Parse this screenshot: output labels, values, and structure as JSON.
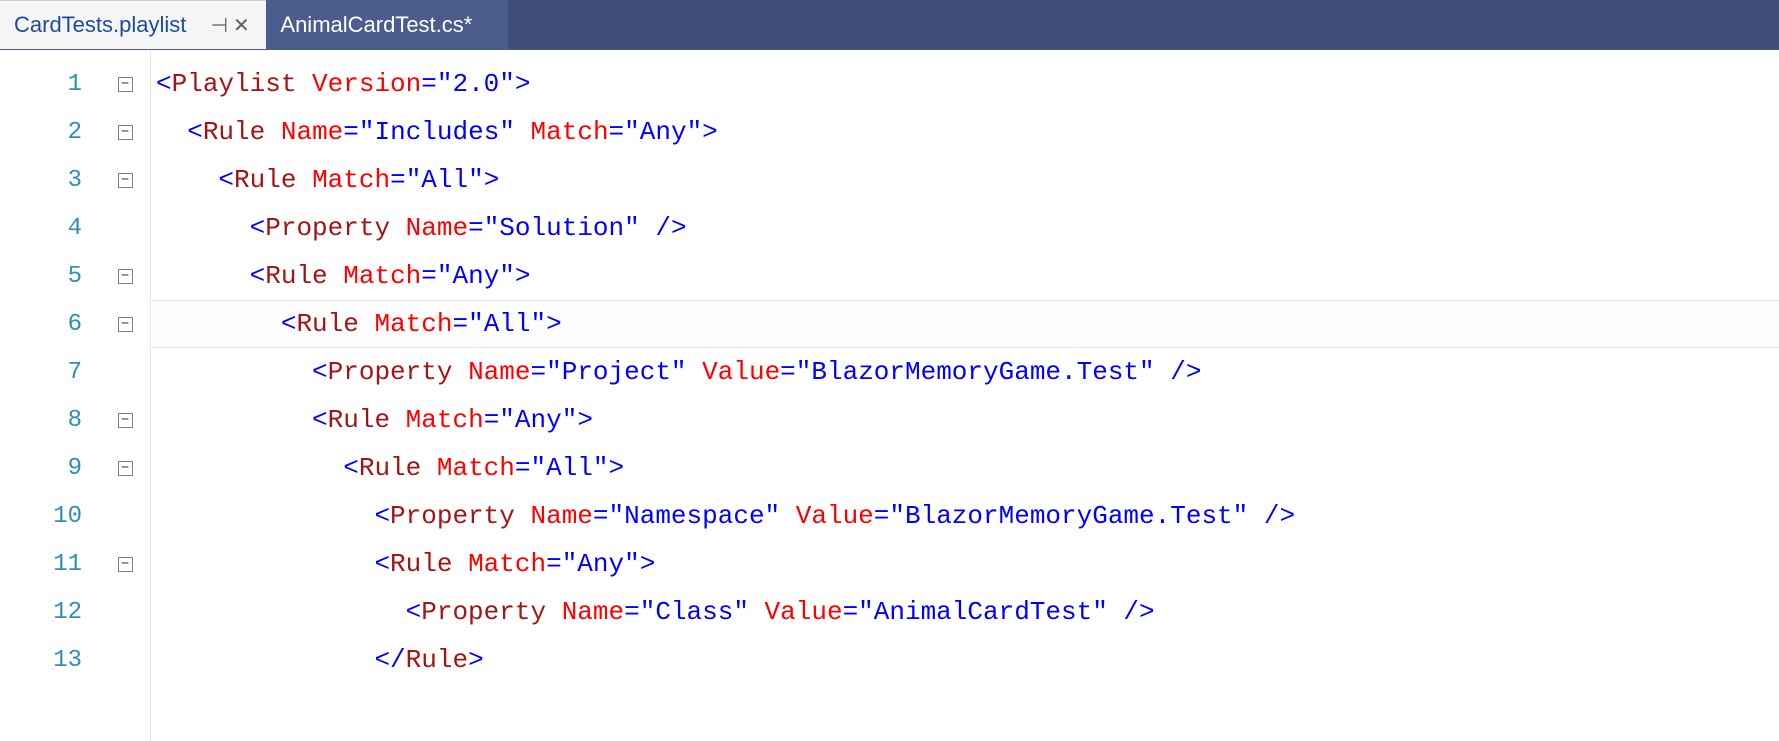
{
  "tabs": [
    {
      "label": "CardTests.playlist",
      "active": true,
      "pinned": true,
      "dirty": false
    },
    {
      "label": "AnimalCardTest.cs*",
      "active": false,
      "pinned": false,
      "dirty": true
    }
  ],
  "icons": {
    "pin": "⊣",
    "close": "✕",
    "collapse": "−"
  },
  "highlight_line": 6,
  "code_lines": [
    {
      "num": 1,
      "fold": true,
      "fold_first": true,
      "indent": 0,
      "tokens": [
        {
          "t": "p",
          "v": "<"
        },
        {
          "t": "el",
          "v": "Playlist"
        },
        {
          "t": "plain",
          "v": " "
        },
        {
          "t": "at",
          "v": "Version"
        },
        {
          "t": "eq",
          "v": "="
        },
        {
          "t": "st",
          "v": "\"2.0\""
        },
        {
          "t": "p",
          "v": ">"
        }
      ]
    },
    {
      "num": 2,
      "fold": true,
      "indent": 1,
      "tokens": [
        {
          "t": "p",
          "v": "<"
        },
        {
          "t": "el",
          "v": "Rule"
        },
        {
          "t": "plain",
          "v": " "
        },
        {
          "t": "at",
          "v": "Name"
        },
        {
          "t": "eq",
          "v": "="
        },
        {
          "t": "st",
          "v": "\"Includes\""
        },
        {
          "t": "plain",
          "v": " "
        },
        {
          "t": "at",
          "v": "Match"
        },
        {
          "t": "eq",
          "v": "="
        },
        {
          "t": "st",
          "v": "\"Any\""
        },
        {
          "t": "p",
          "v": ">"
        }
      ]
    },
    {
      "num": 3,
      "fold": true,
      "indent": 2,
      "tokens": [
        {
          "t": "p",
          "v": "<"
        },
        {
          "t": "el",
          "v": "Rule"
        },
        {
          "t": "plain",
          "v": " "
        },
        {
          "t": "at",
          "v": "Match"
        },
        {
          "t": "eq",
          "v": "="
        },
        {
          "t": "st",
          "v": "\"All\""
        },
        {
          "t": "p",
          "v": ">"
        }
      ]
    },
    {
      "num": 4,
      "fold": false,
      "indent": 3,
      "tokens": [
        {
          "t": "p",
          "v": "<"
        },
        {
          "t": "el",
          "v": "Property"
        },
        {
          "t": "plain",
          "v": " "
        },
        {
          "t": "at",
          "v": "Name"
        },
        {
          "t": "eq",
          "v": "="
        },
        {
          "t": "st",
          "v": "\"Solution\""
        },
        {
          "t": "plain",
          "v": " "
        },
        {
          "t": "p",
          "v": "/>"
        }
      ]
    },
    {
      "num": 5,
      "fold": true,
      "indent": 3,
      "tokens": [
        {
          "t": "p",
          "v": "<"
        },
        {
          "t": "el",
          "v": "Rule"
        },
        {
          "t": "plain",
          "v": " "
        },
        {
          "t": "at",
          "v": "Match"
        },
        {
          "t": "eq",
          "v": "="
        },
        {
          "t": "st",
          "v": "\"Any\""
        },
        {
          "t": "p",
          "v": ">"
        }
      ]
    },
    {
      "num": 6,
      "fold": true,
      "indent": 4,
      "tokens": [
        {
          "t": "p",
          "v": "<"
        },
        {
          "t": "el",
          "v": "Rule"
        },
        {
          "t": "plain",
          "v": " "
        },
        {
          "t": "at",
          "v": "Match"
        },
        {
          "t": "eq",
          "v": "="
        },
        {
          "t": "st",
          "v": "\"All\""
        },
        {
          "t": "p",
          "v": ">"
        }
      ]
    },
    {
      "num": 7,
      "fold": false,
      "indent": 5,
      "tokens": [
        {
          "t": "p",
          "v": "<"
        },
        {
          "t": "el",
          "v": "Property"
        },
        {
          "t": "plain",
          "v": " "
        },
        {
          "t": "at",
          "v": "Name"
        },
        {
          "t": "eq",
          "v": "="
        },
        {
          "t": "st",
          "v": "\"Project\""
        },
        {
          "t": "plain",
          "v": " "
        },
        {
          "t": "at",
          "v": "Value"
        },
        {
          "t": "eq",
          "v": "="
        },
        {
          "t": "st",
          "v": "\"BlazorMemoryGame.Test\""
        },
        {
          "t": "plain",
          "v": " "
        },
        {
          "t": "p",
          "v": "/>"
        }
      ]
    },
    {
      "num": 8,
      "fold": true,
      "indent": 5,
      "tokens": [
        {
          "t": "p",
          "v": "<"
        },
        {
          "t": "el",
          "v": "Rule"
        },
        {
          "t": "plain",
          "v": " "
        },
        {
          "t": "at",
          "v": "Match"
        },
        {
          "t": "eq",
          "v": "="
        },
        {
          "t": "st",
          "v": "\"Any\""
        },
        {
          "t": "p",
          "v": ">"
        }
      ]
    },
    {
      "num": 9,
      "fold": true,
      "indent": 6,
      "tokens": [
        {
          "t": "p",
          "v": "<"
        },
        {
          "t": "el",
          "v": "Rule"
        },
        {
          "t": "plain",
          "v": " "
        },
        {
          "t": "at",
          "v": "Match"
        },
        {
          "t": "eq",
          "v": "="
        },
        {
          "t": "st",
          "v": "\"All\""
        },
        {
          "t": "p",
          "v": ">"
        }
      ]
    },
    {
      "num": 10,
      "fold": false,
      "indent": 7,
      "tokens": [
        {
          "t": "p",
          "v": "<"
        },
        {
          "t": "el",
          "v": "Property"
        },
        {
          "t": "plain",
          "v": " "
        },
        {
          "t": "at",
          "v": "Name"
        },
        {
          "t": "eq",
          "v": "="
        },
        {
          "t": "st",
          "v": "\"Namespace\""
        },
        {
          "t": "plain",
          "v": " "
        },
        {
          "t": "at",
          "v": "Value"
        },
        {
          "t": "eq",
          "v": "="
        },
        {
          "t": "st",
          "v": "\"BlazorMemoryGame.Test\""
        },
        {
          "t": "plain",
          "v": " "
        },
        {
          "t": "p",
          "v": "/>"
        }
      ]
    },
    {
      "num": 11,
      "fold": true,
      "indent": 7,
      "tokens": [
        {
          "t": "p",
          "v": "<"
        },
        {
          "t": "el",
          "v": "Rule"
        },
        {
          "t": "plain",
          "v": " "
        },
        {
          "t": "at",
          "v": "Match"
        },
        {
          "t": "eq",
          "v": "="
        },
        {
          "t": "st",
          "v": "\"Any\""
        },
        {
          "t": "p",
          "v": ">"
        }
      ]
    },
    {
      "num": 12,
      "fold": false,
      "indent": 8,
      "tokens": [
        {
          "t": "p",
          "v": "<"
        },
        {
          "t": "el",
          "v": "Property"
        },
        {
          "t": "plain",
          "v": " "
        },
        {
          "t": "at",
          "v": "Name"
        },
        {
          "t": "eq",
          "v": "="
        },
        {
          "t": "st",
          "v": "\"Class\""
        },
        {
          "t": "plain",
          "v": " "
        },
        {
          "t": "at",
          "v": "Value"
        },
        {
          "t": "eq",
          "v": "="
        },
        {
          "t": "st",
          "v": "\"AnimalCardTest\""
        },
        {
          "t": "plain",
          "v": " "
        },
        {
          "t": "p",
          "v": "/>"
        }
      ]
    },
    {
      "num": 13,
      "fold": false,
      "indent": 7,
      "tokens": [
        {
          "t": "p",
          "v": "</"
        },
        {
          "t": "el",
          "v": "Rule"
        },
        {
          "t": "p",
          "v": ">"
        }
      ]
    }
  ]
}
